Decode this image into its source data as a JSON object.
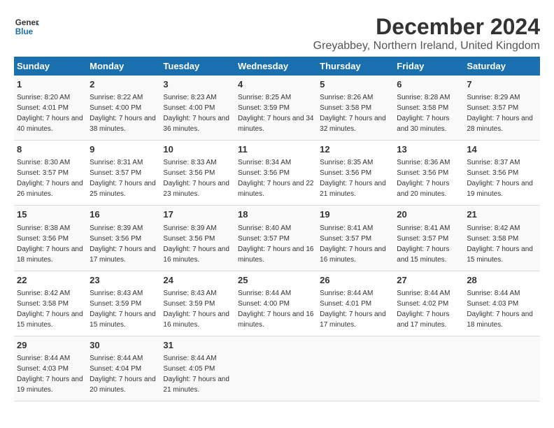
{
  "logo": {
    "line1": "General",
    "line2": "Blue"
  },
  "title": "December 2024",
  "subtitle": "Greyabbey, Northern Ireland, United Kingdom",
  "days_of_week": [
    "Sunday",
    "Monday",
    "Tuesday",
    "Wednesday",
    "Thursday",
    "Friday",
    "Saturday"
  ],
  "weeks": [
    [
      {
        "day": "1",
        "sunrise": "Sunrise: 8:20 AM",
        "sunset": "Sunset: 4:01 PM",
        "daylight": "Daylight: 7 hours and 40 minutes."
      },
      {
        "day": "2",
        "sunrise": "Sunrise: 8:22 AM",
        "sunset": "Sunset: 4:00 PM",
        "daylight": "Daylight: 7 hours and 38 minutes."
      },
      {
        "day": "3",
        "sunrise": "Sunrise: 8:23 AM",
        "sunset": "Sunset: 4:00 PM",
        "daylight": "Daylight: 7 hours and 36 minutes."
      },
      {
        "day": "4",
        "sunrise": "Sunrise: 8:25 AM",
        "sunset": "Sunset: 3:59 PM",
        "daylight": "Daylight: 7 hours and 34 minutes."
      },
      {
        "day": "5",
        "sunrise": "Sunrise: 8:26 AM",
        "sunset": "Sunset: 3:58 PM",
        "daylight": "Daylight: 7 hours and 32 minutes."
      },
      {
        "day": "6",
        "sunrise": "Sunrise: 8:28 AM",
        "sunset": "Sunset: 3:58 PM",
        "daylight": "Daylight: 7 hours and 30 minutes."
      },
      {
        "day": "7",
        "sunrise": "Sunrise: 8:29 AM",
        "sunset": "Sunset: 3:57 PM",
        "daylight": "Daylight: 7 hours and 28 minutes."
      }
    ],
    [
      {
        "day": "8",
        "sunrise": "Sunrise: 8:30 AM",
        "sunset": "Sunset: 3:57 PM",
        "daylight": "Daylight: 7 hours and 26 minutes."
      },
      {
        "day": "9",
        "sunrise": "Sunrise: 8:31 AM",
        "sunset": "Sunset: 3:57 PM",
        "daylight": "Daylight: 7 hours and 25 minutes."
      },
      {
        "day": "10",
        "sunrise": "Sunrise: 8:33 AM",
        "sunset": "Sunset: 3:56 PM",
        "daylight": "Daylight: 7 hours and 23 minutes."
      },
      {
        "day": "11",
        "sunrise": "Sunrise: 8:34 AM",
        "sunset": "Sunset: 3:56 PM",
        "daylight": "Daylight: 7 hours and 22 minutes."
      },
      {
        "day": "12",
        "sunrise": "Sunrise: 8:35 AM",
        "sunset": "Sunset: 3:56 PM",
        "daylight": "Daylight: 7 hours and 21 minutes."
      },
      {
        "day": "13",
        "sunrise": "Sunrise: 8:36 AM",
        "sunset": "Sunset: 3:56 PM",
        "daylight": "Daylight: 7 hours and 20 minutes."
      },
      {
        "day": "14",
        "sunrise": "Sunrise: 8:37 AM",
        "sunset": "Sunset: 3:56 PM",
        "daylight": "Daylight: 7 hours and 19 minutes."
      }
    ],
    [
      {
        "day": "15",
        "sunrise": "Sunrise: 8:38 AM",
        "sunset": "Sunset: 3:56 PM",
        "daylight": "Daylight: 7 hours and 18 minutes."
      },
      {
        "day": "16",
        "sunrise": "Sunrise: 8:39 AM",
        "sunset": "Sunset: 3:56 PM",
        "daylight": "Daylight: 7 hours and 17 minutes."
      },
      {
        "day": "17",
        "sunrise": "Sunrise: 8:39 AM",
        "sunset": "Sunset: 3:56 PM",
        "daylight": "Daylight: 7 hours and 16 minutes."
      },
      {
        "day": "18",
        "sunrise": "Sunrise: 8:40 AM",
        "sunset": "Sunset: 3:57 PM",
        "daylight": "Daylight: 7 hours and 16 minutes."
      },
      {
        "day": "19",
        "sunrise": "Sunrise: 8:41 AM",
        "sunset": "Sunset: 3:57 PM",
        "daylight": "Daylight: 7 hours and 16 minutes."
      },
      {
        "day": "20",
        "sunrise": "Sunrise: 8:41 AM",
        "sunset": "Sunset: 3:57 PM",
        "daylight": "Daylight: 7 hours and 15 minutes."
      },
      {
        "day": "21",
        "sunrise": "Sunrise: 8:42 AM",
        "sunset": "Sunset: 3:58 PM",
        "daylight": "Daylight: 7 hours and 15 minutes."
      }
    ],
    [
      {
        "day": "22",
        "sunrise": "Sunrise: 8:42 AM",
        "sunset": "Sunset: 3:58 PM",
        "daylight": "Daylight: 7 hours and 15 minutes."
      },
      {
        "day": "23",
        "sunrise": "Sunrise: 8:43 AM",
        "sunset": "Sunset: 3:59 PM",
        "daylight": "Daylight: 7 hours and 15 minutes."
      },
      {
        "day": "24",
        "sunrise": "Sunrise: 8:43 AM",
        "sunset": "Sunset: 3:59 PM",
        "daylight": "Daylight: 7 hours and 16 minutes."
      },
      {
        "day": "25",
        "sunrise": "Sunrise: 8:44 AM",
        "sunset": "Sunset: 4:00 PM",
        "daylight": "Daylight: 7 hours and 16 minutes."
      },
      {
        "day": "26",
        "sunrise": "Sunrise: 8:44 AM",
        "sunset": "Sunset: 4:01 PM",
        "daylight": "Daylight: 7 hours and 17 minutes."
      },
      {
        "day": "27",
        "sunrise": "Sunrise: 8:44 AM",
        "sunset": "Sunset: 4:02 PM",
        "daylight": "Daylight: 7 hours and 17 minutes."
      },
      {
        "day": "28",
        "sunrise": "Sunrise: 8:44 AM",
        "sunset": "Sunset: 4:03 PM",
        "daylight": "Daylight: 7 hours and 18 minutes."
      }
    ],
    [
      {
        "day": "29",
        "sunrise": "Sunrise: 8:44 AM",
        "sunset": "Sunset: 4:03 PM",
        "daylight": "Daylight: 7 hours and 19 minutes."
      },
      {
        "day": "30",
        "sunrise": "Sunrise: 8:44 AM",
        "sunset": "Sunset: 4:04 PM",
        "daylight": "Daylight: 7 hours and 20 minutes."
      },
      {
        "day": "31",
        "sunrise": "Sunrise: 8:44 AM",
        "sunset": "Sunset: 4:05 PM",
        "daylight": "Daylight: 7 hours and 21 minutes."
      },
      null,
      null,
      null,
      null
    ]
  ]
}
